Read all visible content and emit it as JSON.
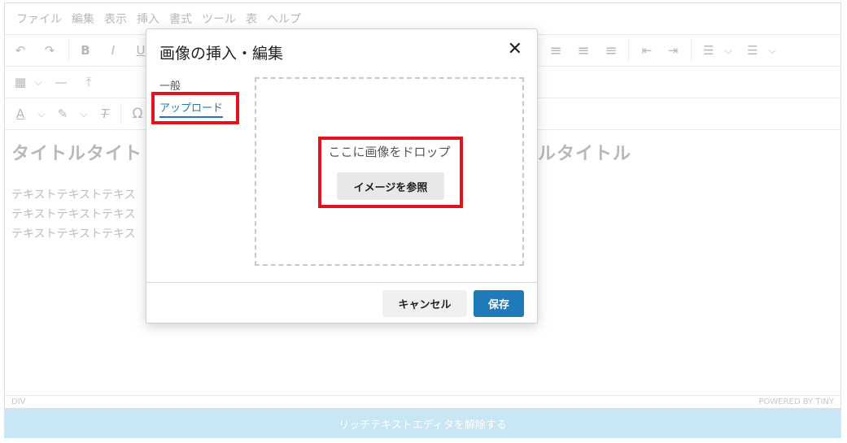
{
  "menubar": {
    "items": [
      "ファイル",
      "編集",
      "表示",
      "挿入",
      "書式",
      "ツール",
      "表",
      "ヘルプ"
    ]
  },
  "toolbar": {
    "row1": [
      "undo-icon",
      "redo-icon",
      "bold-icon",
      "italic-icon",
      "underline-icon",
      "align-center-icon",
      "align-right-icon",
      "align-justify-icon",
      "outdent-icon",
      "indent-icon",
      "numbered-list-icon",
      "bullet-list-icon"
    ],
    "row2": [
      "table-icon",
      "horizontal-rule-icon",
      "upload-icon"
    ],
    "row3": [
      "text-color-icon",
      "highlight-icon",
      "clear-format-icon",
      "special-char-icon"
    ],
    "glyphs": {
      "undo": "↶",
      "redo": "↷",
      "bold": "B",
      "italic": "I",
      "underline": "U",
      "align_center": "≡",
      "align_right": "≡",
      "align_justify": "≡",
      "outdent": "⇤",
      "indent": "⇥",
      "numbered_list": "☰",
      "bullet_list": "☰",
      "chevron": "⌵",
      "table": "▦",
      "hr": "—",
      "upload": "⤒",
      "text_color": "A",
      "highlight": "✎",
      "clear_format": "T",
      "special_char": "Ω"
    }
  },
  "content": {
    "title_left": "タイトルタイト",
    "title_right": "ルタイトル",
    "paragraph_lines": [
      "テキストテキストテキス",
      "テキストテキストテキス",
      "テキストテキストテキス"
    ]
  },
  "statusbar": {
    "path": "DIV",
    "powered": "POWERED BY TINY"
  },
  "bottom_bar": {
    "label": "リッチテキストエディタを解除する"
  },
  "dialog": {
    "title": "画像の挿入・編集",
    "close": "✕",
    "tabs": [
      "一般",
      "アップロード"
    ],
    "dropzone_text": "ここに画像をドロップ",
    "browse_label": "イメージを参照",
    "cancel_label": "キャンセル",
    "save_label": "保存"
  },
  "colors": {
    "accent": "#207ab7",
    "highlight": "#e0141e",
    "bottom_bar": "#c9e6f4"
  }
}
